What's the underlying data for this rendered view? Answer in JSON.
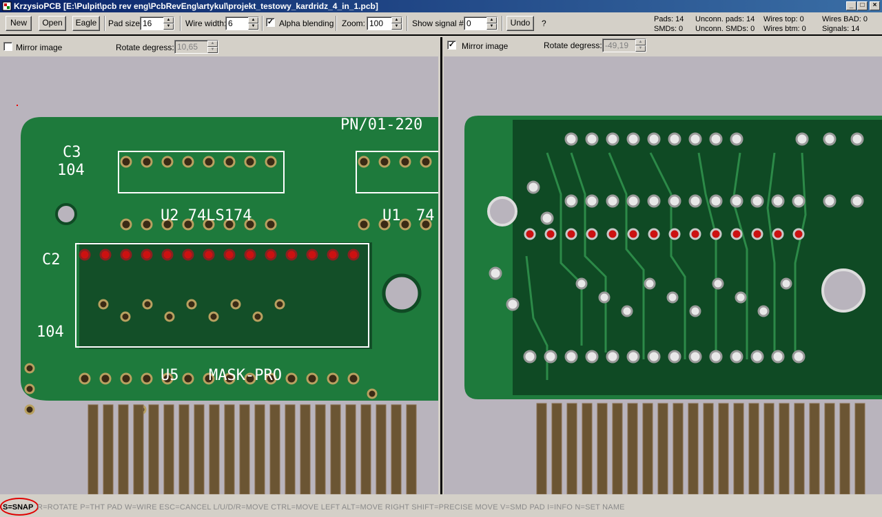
{
  "window": {
    "title": "KrzysioPCB [E:\\Pulpit\\pcb rev eng\\PcbRevEng\\artykul\\projekt_testowy_kardridz_4_in_1.pcb]",
    "minimize": "_",
    "maximize": "□",
    "close": "×"
  },
  "toolbar": {
    "new_label": "New",
    "open_label": "Open",
    "eagle_label": "Eagle",
    "pad_size_label": "Pad size:",
    "pad_size_value": "16",
    "wire_width_label": "Wire width:",
    "wire_width_value": "6",
    "alpha_blending_label": "Alpha blending",
    "alpha_blending_checked": "✓",
    "zoom_label": "Zoom:",
    "zoom_value": "100",
    "show_signal_label": "Show signal #:",
    "show_signal_value": "0",
    "undo_label": "Undo",
    "help_label": "?"
  },
  "stats": {
    "pads": "Pads: 14",
    "smds": "SMDs: 0",
    "unconn_pads": "Unconn. pads: 14",
    "unconn_smds": "Unconn. SMDs: 0",
    "wires_top": "Wires top: 0",
    "wires_btm": "Wires btm: 0",
    "wires_bad": "Wires BAD: 0",
    "signals": "Signals: 14"
  },
  "left_panel": {
    "mirror_label": "Mirror image",
    "mirror_checked": "",
    "rotate_label": "Rotate degress:",
    "rotate_value": "10,65",
    "silk": {
      "c3": "C3",
      "c3_val": "104",
      "u2": "U2 74LS174",
      "u1": "U1",
      "u1_part": "74",
      "pn": "PN/01-220",
      "c2": "C2",
      "c2_val": "104",
      "u5": "U5",
      "mask": "MASK-PRO"
    }
  },
  "right_panel": {
    "mirror_label": "Mirror image",
    "mirror_checked": "✓",
    "rotate_label": "Rotate degress:",
    "rotate_value": "-49,19"
  },
  "statusbar": {
    "snap": "S=SNAP",
    "hints": "R=ROTATE  P=THT PAD  W=WIRE  ESC=CANCEL  L/U/D/R=MOVE  CTRL=MOVE LEFT  ALT=MOVE RIGHT  SHIFT=PRECISE MOVE  V=SMD PAD  I=INFO  N=SET NAME"
  },
  "colors": {
    "pcb_green": "#1e7a3c",
    "pcb_dark": "#0f4a24",
    "pad_gold": "#b8a060",
    "pad_red": "#cc1111",
    "contact_gold": "#8a7050",
    "board_bg": "#b9b4bd"
  }
}
